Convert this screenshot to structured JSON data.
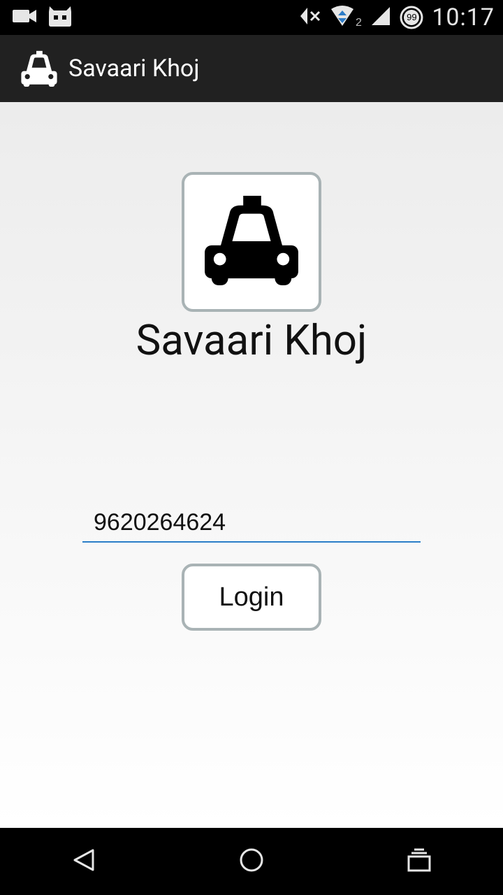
{
  "status_bar": {
    "time": "10:17",
    "signal_sim": "2",
    "notification_badge": "99",
    "icons": [
      "video-camera-icon",
      "cyanogen-mascot-icon",
      "vibrate-mute-icon",
      "data-transfer-icon",
      "signal-strength-icon",
      "alarm-badge-icon"
    ]
  },
  "action_bar": {
    "title": "Savaari Khoj",
    "icon": "taxi-icon"
  },
  "main": {
    "logo_icon": "taxi-icon",
    "app_name": "Savaari Khoj",
    "phone_input_value": "9620264624",
    "login_label": "Login"
  },
  "nav_bar": {
    "buttons": [
      "back-icon",
      "home-icon",
      "recent-apps-icon"
    ]
  },
  "colors": {
    "action_bar": "#212121",
    "input_underline": "#2a7ec8",
    "box_border": "#a9b3b5"
  }
}
